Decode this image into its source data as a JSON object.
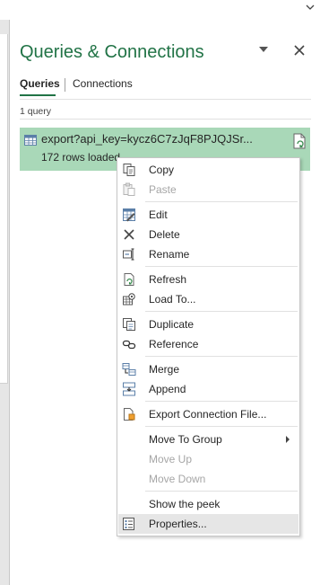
{
  "pane": {
    "title": "Queries & Connections",
    "tabs": [
      {
        "label": "Queries",
        "active": true
      },
      {
        "label": "Connections",
        "active": false
      }
    ],
    "query_count": "1 query",
    "query": {
      "name": "export?api_key=kycz6C7zJqF8PJQJSr...",
      "status": "172 rows loaded."
    }
  },
  "context_menu": {
    "items": [
      {
        "label": "Copy",
        "icon": "copy-icon",
        "enabled": true
      },
      {
        "label": "Paste",
        "icon": "paste-icon",
        "enabled": false
      },
      {
        "label": "Edit",
        "icon": "edit-icon",
        "enabled": true
      },
      {
        "label": "Delete",
        "icon": "delete-icon",
        "enabled": true
      },
      {
        "label": "Rename",
        "icon": "rename-icon",
        "enabled": true
      },
      {
        "label": "Refresh",
        "icon": "refresh-icon",
        "enabled": true
      },
      {
        "label": "Load To...",
        "icon": "load-to-icon",
        "enabled": true
      },
      {
        "label": "Duplicate",
        "icon": "duplicate-icon",
        "enabled": true
      },
      {
        "label": "Reference",
        "icon": "reference-icon",
        "enabled": true
      },
      {
        "label": "Merge",
        "icon": "merge-icon",
        "enabled": true
      },
      {
        "label": "Append",
        "icon": "append-icon",
        "enabled": true
      },
      {
        "label": "Export Connection File...",
        "icon": "export-connection-icon",
        "enabled": true
      },
      {
        "label": "Move To Group",
        "icon": "",
        "enabled": true,
        "submenu": true
      },
      {
        "label": "Move Up",
        "icon": "",
        "enabled": false
      },
      {
        "label": "Move Down",
        "icon": "",
        "enabled": false
      },
      {
        "label": "Show the peek",
        "icon": "",
        "enabled": true
      },
      {
        "label": "Properties...",
        "icon": "properties-icon",
        "enabled": true,
        "highlighted": true
      }
    ]
  },
  "colors": {
    "accent": "#217346",
    "selection": "#a9d8b8",
    "menu_hover": "#e6e6e6"
  }
}
